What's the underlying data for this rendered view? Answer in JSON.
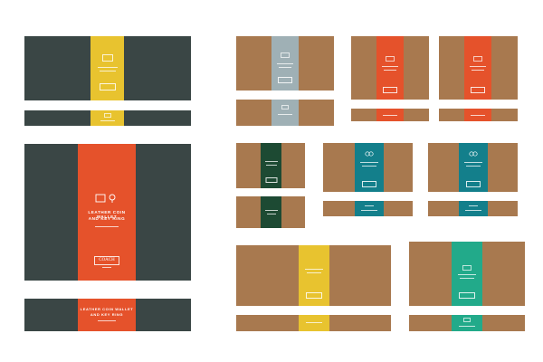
{
  "colors": {
    "slate": "#3a4645",
    "kraft": "#a8794f",
    "yellow": "#e8c32f",
    "orange": "#e5522b",
    "grey_blue": "#9fb0b5",
    "dark_green": "#1d4a33",
    "teal": "#137f8b",
    "emerald": "#22aa8a"
  },
  "featured_box": {
    "title_line1": "LEATHER COIN WALLET",
    "title_line2": "AND KEY RING",
    "brand": "COACH"
  },
  "featured_lid": {
    "title_line1": "LEATHER COIN WALLET",
    "title_line2": "AND KEY RING"
  }
}
